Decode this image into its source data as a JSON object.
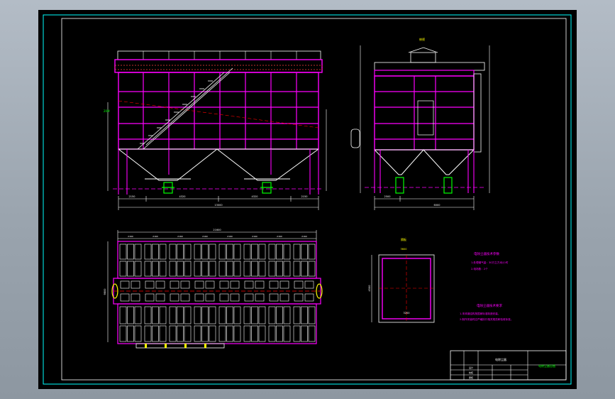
{
  "drawing": {
    "colors": {
      "background": "#000000",
      "border": "#00ffff",
      "frame": "#ffffff",
      "structure": "#ff00ff",
      "hopper": "#ffffff",
      "annotation": "#ffff00",
      "highlight": "#00ff00",
      "centerline": "#ff0000",
      "text": "#ffffff"
    },
    "icons": [
      "title-block",
      "section-view",
      "elevation-view",
      "plan-view"
    ],
    "top_view_label": "俯视",
    "front_dims": [
      "2150",
      "4320",
      "4320",
      "2150"
    ],
    "front_total": "13000",
    "side_dims": [
      "2500",
      "6000"
    ],
    "plan_dims": [
      "2160",
      "2160",
      "2160",
      "2160",
      "2160",
      "2160",
      "2160",
      "2160"
    ],
    "plan_total": "21600",
    "side_label_left": "20M",
    "plan_side_dim": "9800",
    "inset_title": "隔板",
    "inset_dim_top": "3600",
    "inset_dim_side": "4500",
    "inset_dim_bottom": "3200",
    "note_block_1": {
      "title": "电除尘器技术参数",
      "lines": [
        "1.处理烟气量：30万立方米/小时",
        "2.电场数：2个"
      ]
    },
    "note_block_2": {
      "title": "电除尘器技术要求",
      "lines": [
        "1.本体钢结构按国家标准制造安装，",
        "2.制作安装时应严格执行相关规范和验收标准。"
      ]
    },
    "title_block": {
      "project": "电除尘器",
      "drawing_name": "电除尘器总图",
      "rows": [
        "设计",
        "校核",
        "审核"
      ]
    }
  }
}
